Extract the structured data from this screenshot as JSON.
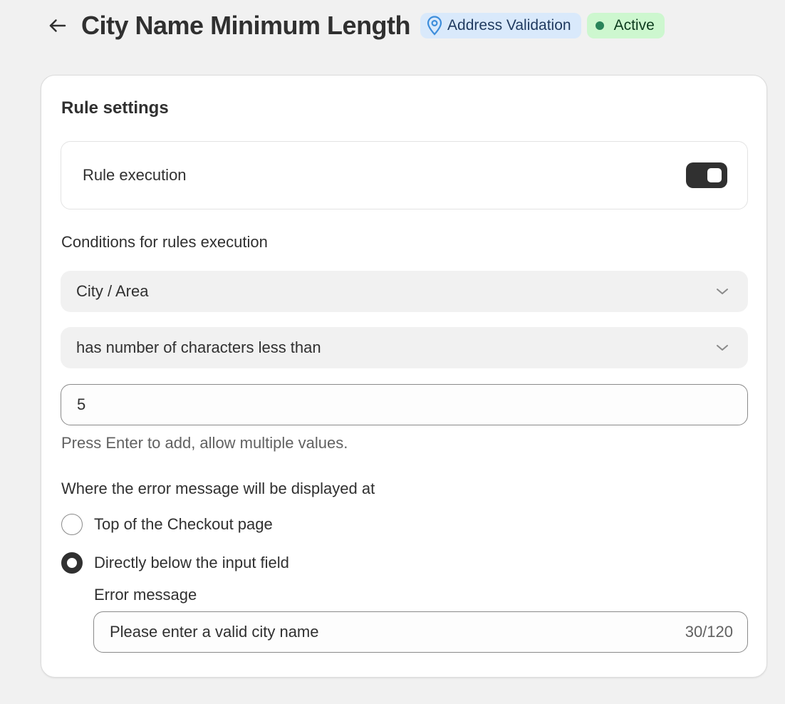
{
  "header": {
    "title": "City Name Minimum Length",
    "category_badge": "Address Validation",
    "status_badge": "Active"
  },
  "card": {
    "title": "Rule settings",
    "rule_execution": {
      "label": "Rule execution",
      "enabled": true
    },
    "conditions": {
      "label": "Conditions for rules execution",
      "field_select": "City / Area",
      "operator_select": "has number of characters less than",
      "value": "5",
      "help_text": "Press Enter to add, allow multiple values."
    },
    "display": {
      "label": "Where the error message will be displayed at",
      "options": [
        {
          "label": "Top of the Checkout page",
          "checked": false
        },
        {
          "label": "Directly below the input field",
          "checked": true
        }
      ],
      "error_message_label": "Error message",
      "error_message_value": "Please enter a valid city name",
      "error_message_counter": "30/120"
    }
  },
  "colors": {
    "background": "#f1f1f1",
    "info_badge": "#d9e9fb",
    "success_badge": "#cdf7cf",
    "success_dot": "#29845a",
    "toggle_on": "#303030",
    "pin_icon": "#3d8ddb"
  }
}
